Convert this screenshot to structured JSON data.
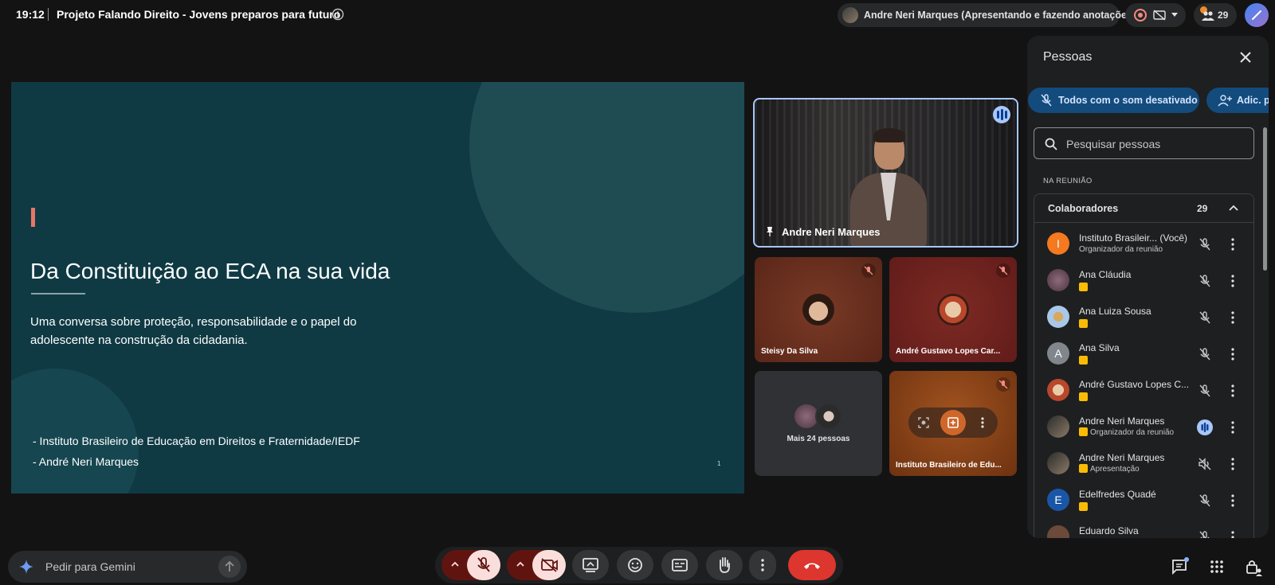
{
  "topbar": {
    "time": "19:12",
    "meeting_title": "Projeto Falando Direito - Jovens preparos para futuro",
    "presenter_status": "Andre Neri Marques (Apresentando e fazendo anotações)",
    "participant_count": "29"
  },
  "slide": {
    "title": "Da Constituição ao ECA na sua vida",
    "subtitle": "Uma conversa sobre proteção, responsabilidade e o papel do adolescente na construção da cidadania.",
    "credit_1": "- Instituto Brasileiro de Educação em Direitos e Fraternidade/IEDF",
    "credit_2": "- André Neri Marques",
    "page_number": "1"
  },
  "tiles": {
    "main_label": "Andre Neri Marques",
    "tile1_label": "Steisy Da Silva",
    "tile2_label": "André Gustavo Lopes Car...",
    "tile3_label": "Mais 24 pessoas",
    "tile4_label": "Instituto Brasileiro de Edu..."
  },
  "panel": {
    "title": "Pessoas",
    "mute_all_label": "Todos com o som desativado",
    "add_label": "Adic. p",
    "search_placeholder": "Pesquisar pessoas",
    "section_label": "NA REUNIÃO",
    "group_name": "Colaboradores",
    "group_count": "29",
    "people": [
      {
        "name": "Instituto Brasileir...  (Você)",
        "role": "Organizador da reunião",
        "initial": "I",
        "color": "#f4791f"
      },
      {
        "name": "Ana Cláudia",
        "role": ""
      },
      {
        "name": "Ana Luiza Sousa",
        "role": ""
      },
      {
        "name": "Ana Silva",
        "role": "",
        "initial": "A",
        "color": "#80868b"
      },
      {
        "name": "André Gustavo Lopes C...",
        "role": ""
      },
      {
        "name": "Andre Neri Marques",
        "role": "Organizador da reunião"
      },
      {
        "name": "Andre Neri Marques",
        "role": "Apresentação"
      },
      {
        "name": "Edelfredes Quadé",
        "role": "",
        "initial": "E",
        "color": "#1a73e8"
      },
      {
        "name": "Eduardo Silva",
        "role": ""
      }
    ]
  },
  "bottom": {
    "gemini_placeholder": "Pedir para Gemini"
  },
  "colors": {
    "slide_bg": "#0f3a44",
    "accent": "#e8756a",
    "hangup": "#dc362e",
    "active_border": "#a8c7fa"
  }
}
